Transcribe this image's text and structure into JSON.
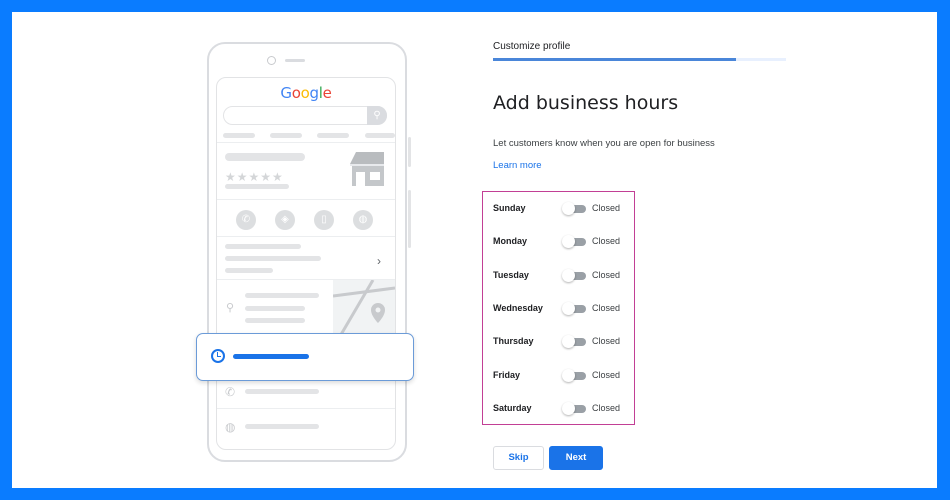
{
  "colors": {
    "frame": "#0a7cff",
    "accent": "#1a73e8",
    "highlight_border": "#c23f95"
  },
  "illustration": {
    "logo": [
      {
        "char": "G",
        "color": "#4285f4"
      },
      {
        "char": "o",
        "color": "#ea4335"
      },
      {
        "char": "o",
        "color": "#fbbc05"
      },
      {
        "char": "g",
        "color": "#4285f4"
      },
      {
        "char": "l",
        "color": "#34a853"
      },
      {
        "char": "e",
        "color": "#ea4335"
      }
    ],
    "stars": "★★★★★",
    "search_icon": "⚲",
    "chevron": "›",
    "action_icons": [
      "✆",
      "◈",
      "▯",
      "◍"
    ],
    "pin_icon": "⚲",
    "phone_icon": "✆",
    "globe_icon": "◍"
  },
  "header": {
    "step_label": "Customize profile",
    "progress": 0.83
  },
  "main": {
    "title": "Add business hours",
    "subtitle": "Let customers know when you are open for business",
    "learn_more": "Learn more"
  },
  "hours": [
    {
      "day": "Sunday",
      "status": "Closed",
      "open": false
    },
    {
      "day": "Monday",
      "status": "Closed",
      "open": false
    },
    {
      "day": "Tuesday",
      "status": "Closed",
      "open": false
    },
    {
      "day": "Wednesday",
      "status": "Closed",
      "open": false
    },
    {
      "day": "Thursday",
      "status": "Closed",
      "open": false
    },
    {
      "day": "Friday",
      "status": "Closed",
      "open": false
    },
    {
      "day": "Saturday",
      "status": "Closed",
      "open": false
    }
  ],
  "actions": {
    "skip": "Skip",
    "next": "Next"
  }
}
